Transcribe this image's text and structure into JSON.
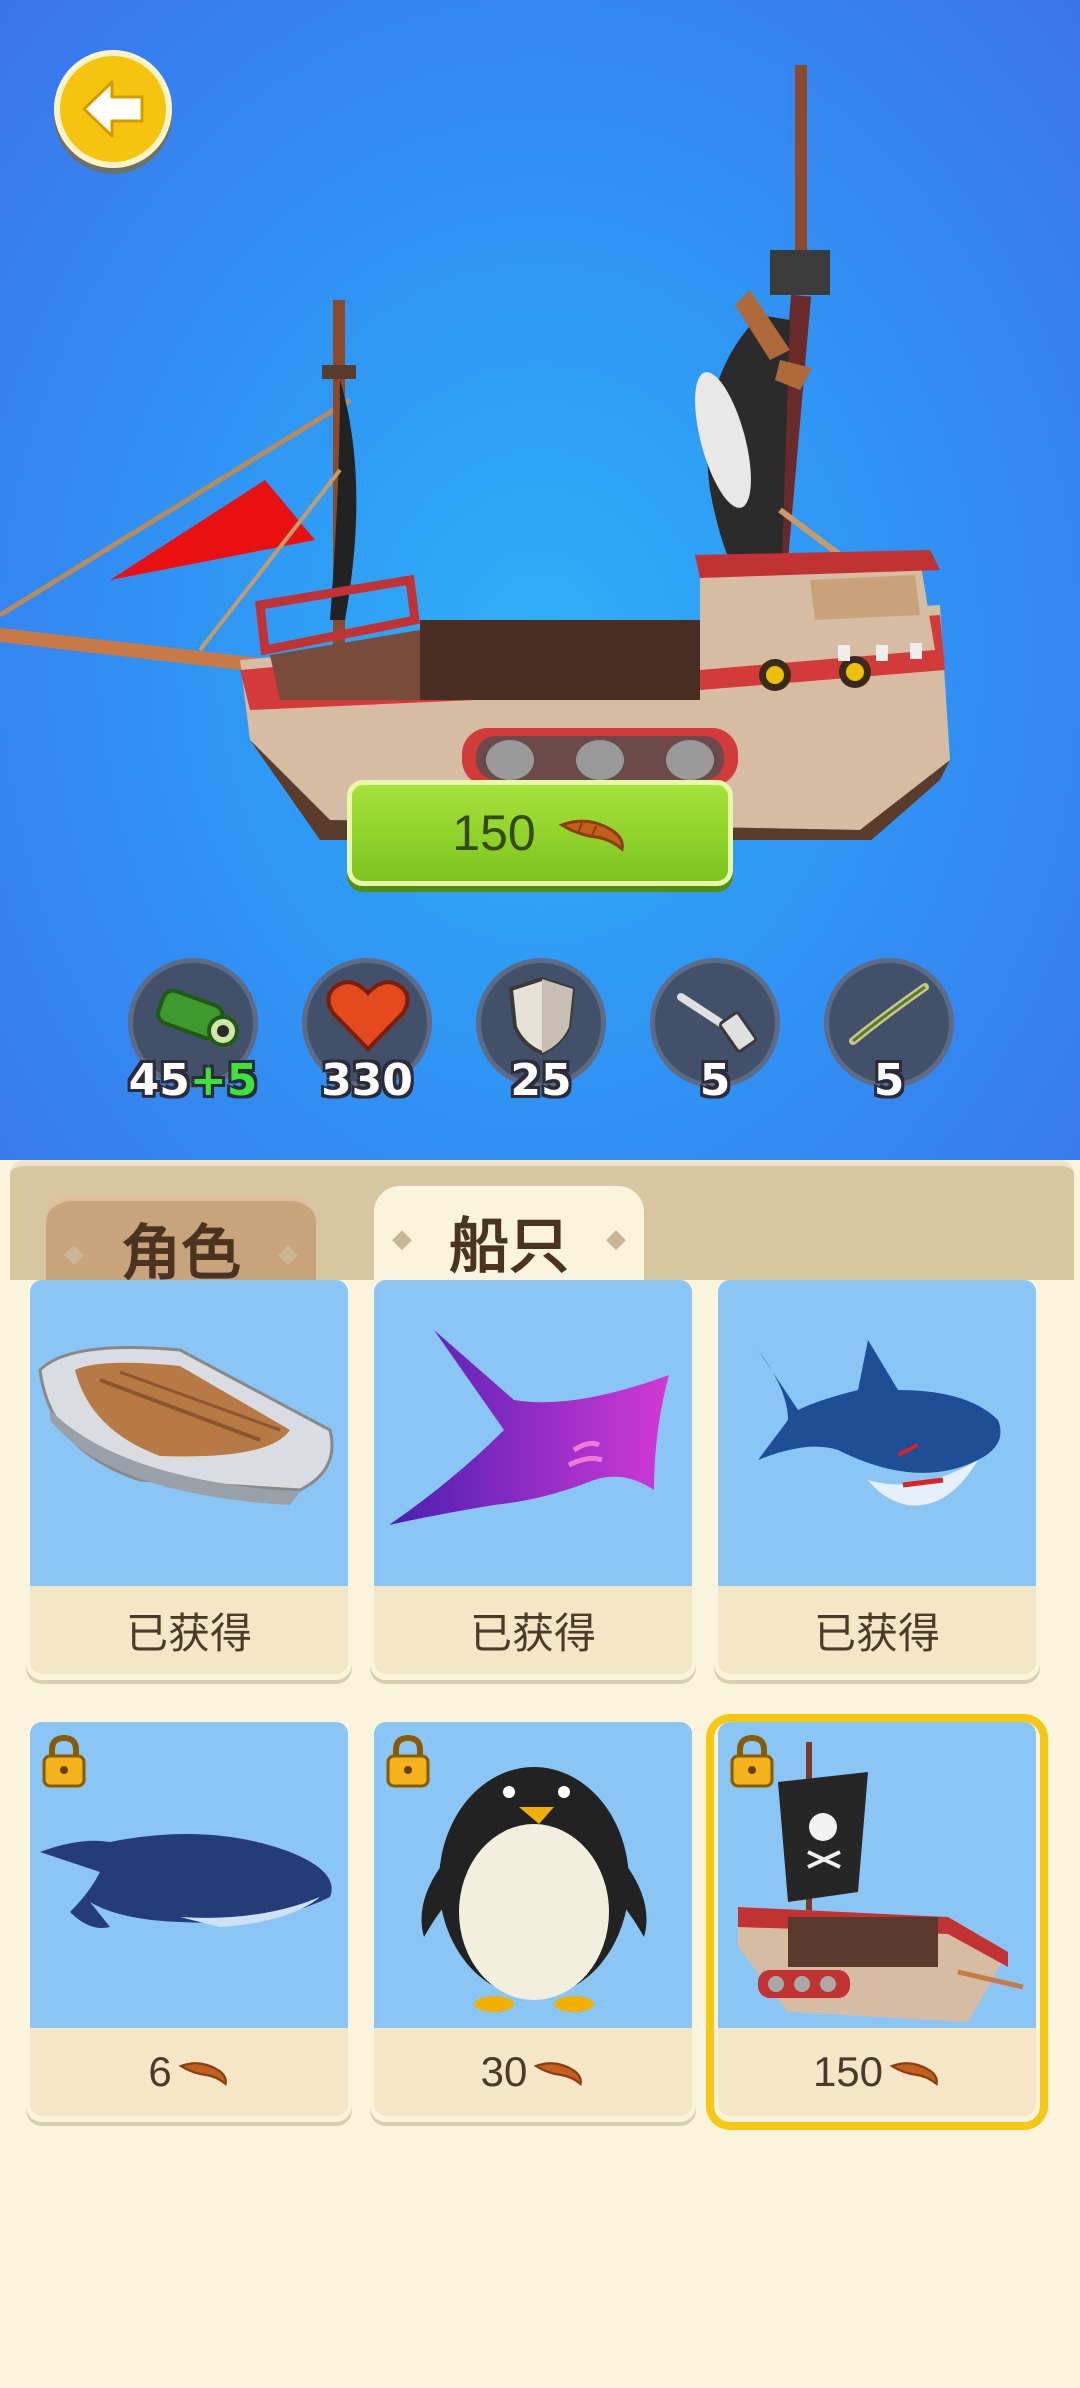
{
  "price_button": {
    "amount": "150",
    "currency_icon": "worm-icon"
  },
  "stats": [
    {
      "icon": "cannon-icon",
      "value": "45",
      "bonus": "+5"
    },
    {
      "icon": "heart-icon",
      "value": "330",
      "bonus": ""
    },
    {
      "icon": "shield-icon",
      "value": "25",
      "bonus": ""
    },
    {
      "icon": "hammer-icon",
      "value": "5",
      "bonus": ""
    },
    {
      "icon": "fishing-rod-icon",
      "value": "5",
      "bonus": ""
    }
  ],
  "tabs": {
    "character": "角色",
    "ship": "船只"
  },
  "cards": [
    {
      "name": "speedboat",
      "status": "已获得",
      "locked": false
    },
    {
      "name": "manta-ray",
      "status": "已获得",
      "locked": false
    },
    {
      "name": "shark",
      "status": "已获得",
      "locked": false
    },
    {
      "name": "whale",
      "price": "6",
      "locked": true
    },
    {
      "name": "penguin",
      "price": "30",
      "locked": true
    },
    {
      "name": "pirate-ship",
      "price": "150",
      "locked": true,
      "selected": true
    }
  ],
  "colors": {
    "sky": "#2f95f4",
    "accent_yellow": "#f6c40f",
    "buy_green": "#8ed12a",
    "card_sky": "#8ac6f5",
    "panel_cream": "#fbf4dc",
    "tab_brown": "#c7a47c"
  }
}
